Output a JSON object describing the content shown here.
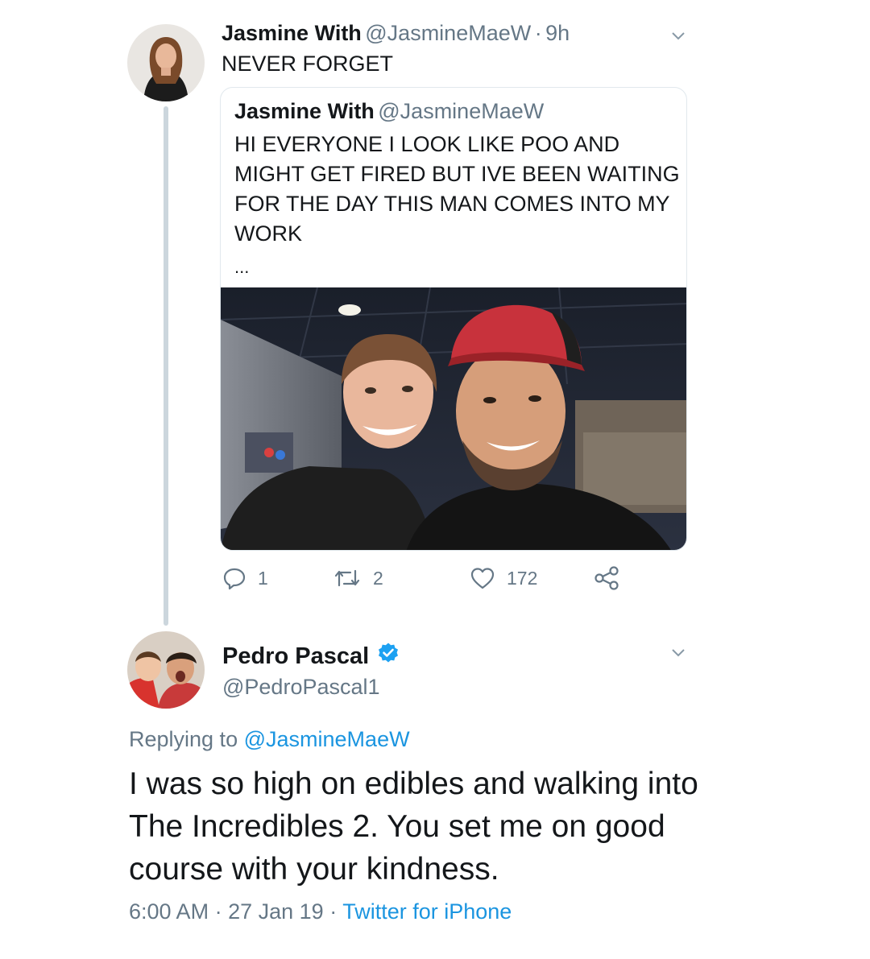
{
  "tweet1": {
    "author_name": "Jasmine With",
    "author_handle": "@JasmineMaeW",
    "separator": "·",
    "time": "9h",
    "text": "NEVER FORGET",
    "quoted": {
      "author_name": "Jasmine With",
      "author_handle": "@JasmineMaeW",
      "text": "HI EVERYONE I LOOK LIKE POO AND MIGHT GET FIRED BUT IVE BEEN WAITING FOR THE DAY THIS MAN COMES INTO MY WORK",
      "more": "..."
    },
    "actions": {
      "replies": "1",
      "retweets": "2",
      "likes": "172"
    }
  },
  "tweet2": {
    "author_name": "Pedro Pascal",
    "author_handle": "@PedroPascal1",
    "replying_prefix": "Replying to",
    "replying_handle": "@JasmineMaeW",
    "text": "I was so high on edibles and walking into The Incredibles 2. You set me on good course with your kindness.",
    "time": "6:00 AM",
    "date": "27 Jan 19",
    "separator": "·",
    "source": "Twitter for iPhone"
  },
  "colors": {
    "text": "#14171a",
    "secondary": "#657786",
    "link": "#1b95e0",
    "verified": "#1da1f2",
    "border": "#e1e8ed",
    "thread_line": "#ccd6dd"
  },
  "icons": [
    "chevron-down-icon",
    "reply-icon",
    "retweet-icon",
    "like-icon",
    "share-icon",
    "verified-badge-icon"
  ]
}
